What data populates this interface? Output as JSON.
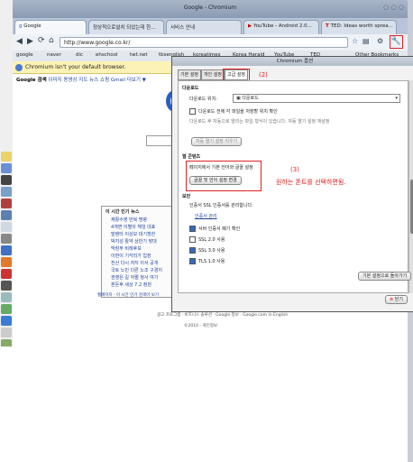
{
  "window": {
    "title": "Google - Chromium",
    "tabs": [
      {
        "label": "Google"
      },
      {
        "label": "정상적으로설치 되었는데 한..."
      },
      {
        "label": "서비스 안내"
      },
      {
        "label": "YouTube - Android 2.0..."
      },
      {
        "label": "TED: Ideas worth sprea..."
      }
    ],
    "url": "http://www.google.co.kr/",
    "bookmarks": [
      {
        "label": "google"
      },
      {
        "label": "naver"
      },
      {
        "label": "dic"
      },
      {
        "label": "ehschool"
      },
      {
        "label": "twt.net"
      },
      {
        "label": "tbsenglish"
      },
      {
        "label": "koreatimes"
      },
      {
        "label": "Korea Herald"
      },
      {
        "label": "YouTube"
      },
      {
        "label": "TED"
      },
      {
        "label": "Other Bookmarks"
      }
    ],
    "infobar_text": "Chromium isn't your default browser."
  },
  "google_page": {
    "nav": [
      "Google 검색",
      "이미지",
      "동영상",
      "지도",
      "뉴스",
      "쇼핑",
      "Gmail",
      "더보기 ▼"
    ],
    "panel_title": "이 시간 인기 뉴스",
    "panel_items": [
      "재활수영 반복 명령",
      "4개변 이별의 헤임 대표",
      "발렌타 이상보 대기쟁한",
      "박지성 활약 상반기 맞대",
      "막장부 비례후보",
      "이번이 기각리가 입장",
      "전산 다시 저지 이서 공개",
      "국토 노민 다른 노조 구경지",
      "권영은 길 어쩔 청사 여기",
      "혼돈후 세상 7.2 정원"
    ],
    "panel_footer": "웹페이지 · 이 시간 인기 검색어 보기",
    "footer_links": "광고 프로그램 · 비즈니스 솔루션 · Google 정보 · Google.com in English",
    "copyright": "©2010 - 개인정보"
  },
  "dialog": {
    "title": "Chromium 옵션",
    "tabs": [
      "기본 설정",
      "개인 설정",
      "고급 설정"
    ],
    "section_download": "다운로드",
    "download_location_label": "다운로드 위치:",
    "download_location_value": "다운로드",
    "ask_checkbox_label": "다운로드 전에 각 파일을 저장할 위치 확인",
    "auto_open_text": "다운로드 후 자동으로 열리는 파일 형식이 있습니다. 자동 열기 설정 재설정",
    "reset_auto_open_button": "자동 열기 설정 지우기",
    "section_web_content": "웹 콘텐츠",
    "font_desc": "페이지에서 기본 언어와 글꼴 설정",
    "font_button": "글꼴 및 언어 설정 변경",
    "section_security": "보안",
    "ssl_label": "인증서 SSL 인증서를 관리합니다.",
    "manage_certs_link": "인증서 관리",
    "checks": [
      {
        "label": "서버 인증서 폐기 확인",
        "checked": true
      },
      {
        "label": "SSL 2.0 사용",
        "checked": false
      },
      {
        "label": "SSL 3.0 사용",
        "checked": true
      },
      {
        "label": "TLS 1.0 사용",
        "checked": true
      }
    ],
    "reset_defaults_button": "기본 설정으로 돌아가기",
    "close_button": "닫기"
  },
  "annotations": {
    "a2": "(2)",
    "a3": "(3)",
    "a3_text": "원하는 폰트를 선택하면됨."
  },
  "colors": {
    "annotation": "#dd2222",
    "link": "#224499",
    "infobar": "#fdf2b5"
  }
}
